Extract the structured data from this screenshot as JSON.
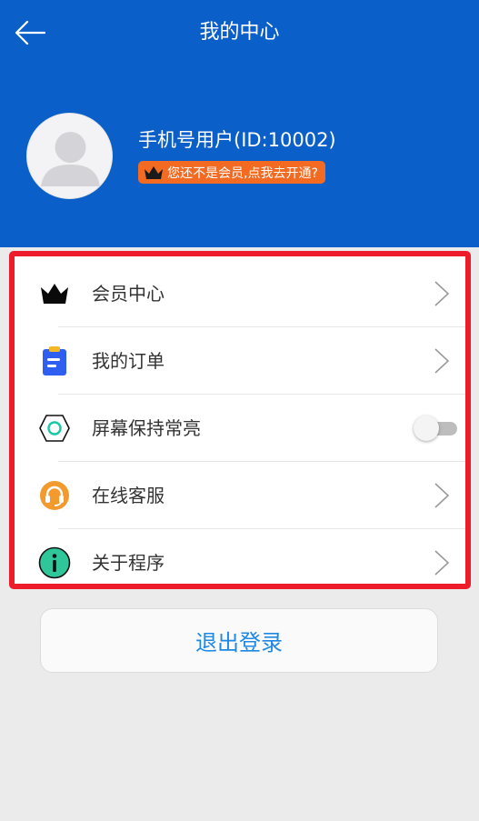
{
  "header": {
    "title": "我的中心",
    "user_name": "手机号用户(ID:10002)",
    "vip_prompt": "您还不是会员,点我去开通?"
  },
  "menu": {
    "items": [
      {
        "label": "会员中心",
        "icon": "crown-icon",
        "control": "chevron"
      },
      {
        "label": "我的订单",
        "icon": "clipboard-icon",
        "control": "chevron"
      },
      {
        "label": "屏幕保持常亮",
        "icon": "hexagon-icon",
        "control": "toggle",
        "toggle_on": false
      },
      {
        "label": "在线客服",
        "icon": "headset-icon",
        "control": "chevron"
      },
      {
        "label": "关于程序",
        "icon": "info-icon",
        "control": "chevron"
      }
    ]
  },
  "logout": {
    "label": "退出登录"
  },
  "colors": {
    "header_bg": "#0a5fc9",
    "vip_badge": "#f36a22",
    "highlight_border": "#ee1b2b",
    "logout_text": "#1e88e5"
  }
}
